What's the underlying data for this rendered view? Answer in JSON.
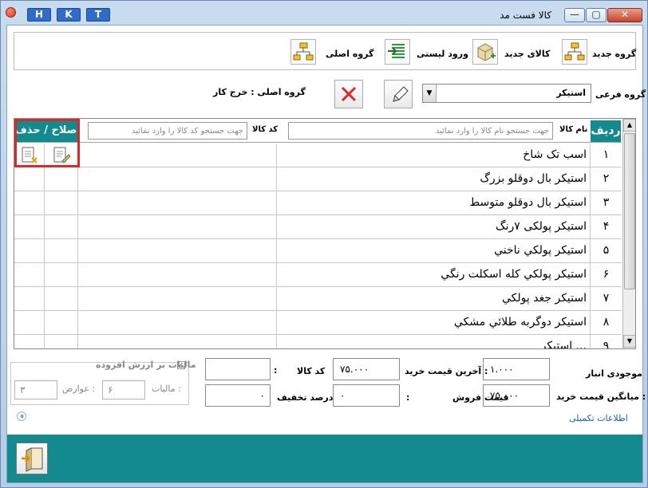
{
  "window": {
    "title": "کالا فست مد",
    "hkt": [
      "H",
      "K",
      "T"
    ],
    "controls": [
      "—",
      "▢",
      "✕"
    ]
  },
  "toolbar": {
    "new_group": "گروه جدید",
    "new_item": "کالای جدید",
    "list_import": "ورود لیستی",
    "main_group": "گروه اصلی"
  },
  "filter": {
    "subgroup_label": "گروه فرعی :",
    "subgroup_value": "استیکر",
    "main_group_label": "گروه اصلی : خرج کار"
  },
  "grid": {
    "col_row": "ردیف",
    "col_name": "نام کالا",
    "name_placeholder": "جهت جستجو نام کالا را وارد نمائید",
    "col_code": "کد کالا",
    "code_placeholder": "جهت جستجو کد کالا را وارد نمائید",
    "col_edit": "صلاح / حذف",
    "rows": [
      {
        "no": "۱",
        "name": "اسب تک شاخ"
      },
      {
        "no": "۲",
        "name": "استیکر بال دوقلو بزرگ"
      },
      {
        "no": "۳",
        "name": "استیکر بال دوقلو متوسط"
      },
      {
        "no": "۴",
        "name": "استیکر پولکی ۷رنگ"
      },
      {
        "no": "۵",
        "name": "استیکر پولکي ناخني"
      },
      {
        "no": "۶",
        "name": "استیکر پولکي کله اسکلت رنگي"
      },
      {
        "no": "۷",
        "name": "استیکر جغد پولکي"
      },
      {
        "no": "۸",
        "name": "استیکر دوگربه طلائي مشکي"
      },
      {
        "no": "۹",
        "name": "استیکر ..."
      }
    ]
  },
  "form": {
    "stock_label": "موجودی انبار",
    "stock_value": "۱.۰۰۰",
    "last_buy_label": "آخرین قیمت خرید :",
    "last_buy_value": "۷۵.۰۰۰",
    "code_label": "کد کالا",
    "code_colon": ":",
    "avg_buy_label": "میانگین قیمت خرید :",
    "avg_buy_value": "۷۵.۰۰۰",
    "sell_label": "قیمت فروش",
    "sell_colon": ":",
    "sell_value": "۰",
    "discount_label": "درصد تخفیف",
    "discount_value": "۰",
    "vat_label": "مالیات بر ارزش افزوده",
    "tax_label": "مالیات :",
    "tax_value": "۶",
    "duty_label": "عوارض :",
    "duty_value": "۳",
    "more_info": "اطلاعات تکمیلی",
    "expand": "»"
  }
}
